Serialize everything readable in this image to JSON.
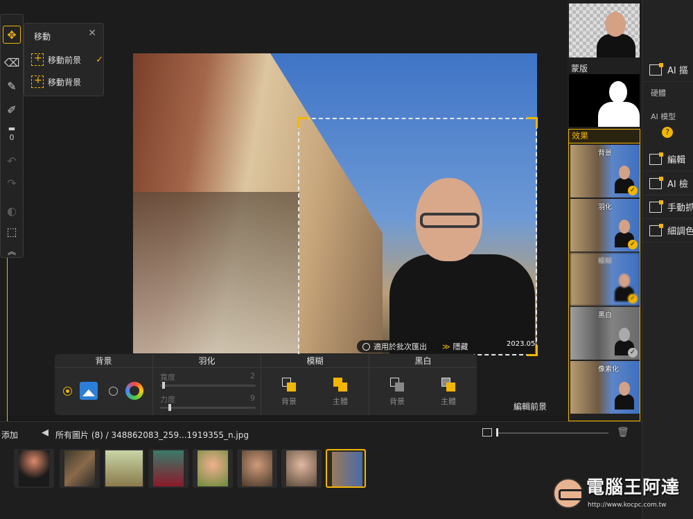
{
  "toolbar": {
    "tools": [
      "move-icon",
      "eraser-icon",
      "brush-icon",
      "paint-icon",
      "roller-icon"
    ],
    "zero_badge": "0"
  },
  "move_popup": {
    "title": "移動",
    "items": [
      {
        "label": "移動前景",
        "checked": true
      },
      {
        "label": "移動背景",
        "checked": false
      }
    ]
  },
  "canvas": {
    "batch_label": "適用於批次匯出",
    "hide_label": "隱藏",
    "date_stamp": "2023.05"
  },
  "effects_panel": {
    "background": {
      "header": "背景"
    },
    "feather": {
      "header": "羽化",
      "width_label": "寬度",
      "width_value": "2",
      "strength_label": "力度",
      "strength_value": "9",
      "width_level": 0.02,
      "strength_level": 0.09
    },
    "blur": {
      "header": "模糊",
      "bg_label": "背景",
      "subject_label": "主體"
    },
    "bw": {
      "header": "黑白",
      "bg_label": "背景",
      "subject_label": "主體"
    }
  },
  "edit_foreground": "編輯前景",
  "right_thumbs": {
    "mask_label": "蒙版",
    "effects_header": "效果",
    "effects": [
      {
        "label": "背景",
        "checked": true
      },
      {
        "label": "羽化",
        "checked": true
      },
      {
        "label": "模糊",
        "checked": true
      },
      {
        "label": "黑白",
        "checked": true
      },
      {
        "label": "像素化",
        "checked": false
      }
    ]
  },
  "right_panel": {
    "rows": [
      {
        "label": "AI 摳",
        "icon": "ai-cutout-icon"
      },
      {
        "label": "編輯",
        "icon": "crop-icon"
      },
      {
        "label": "AI 檢",
        "icon": "ai-detect-icon"
      },
      {
        "label": "手動抓",
        "icon": "manual-select-icon"
      },
      {
        "label": "細調色",
        "icon": "fine-tune-icon"
      }
    ],
    "hardness_label": "硬體",
    "ai_model_label": "AI 模型"
  },
  "bottom": {
    "add_label": "添加",
    "breadcrumb": "所有圖片 (8)  /  348862083_259...1919355_n.jpg",
    "thumb_count": 8,
    "selected_index": 7
  },
  "watermark": {
    "text": "電腦王阿達",
    "url": "http://www.kocpc.com.tw"
  },
  "colors": {
    "accent": "#f2b600",
    "bg": "#1a1a1a",
    "panel": "#2a2a2a"
  }
}
